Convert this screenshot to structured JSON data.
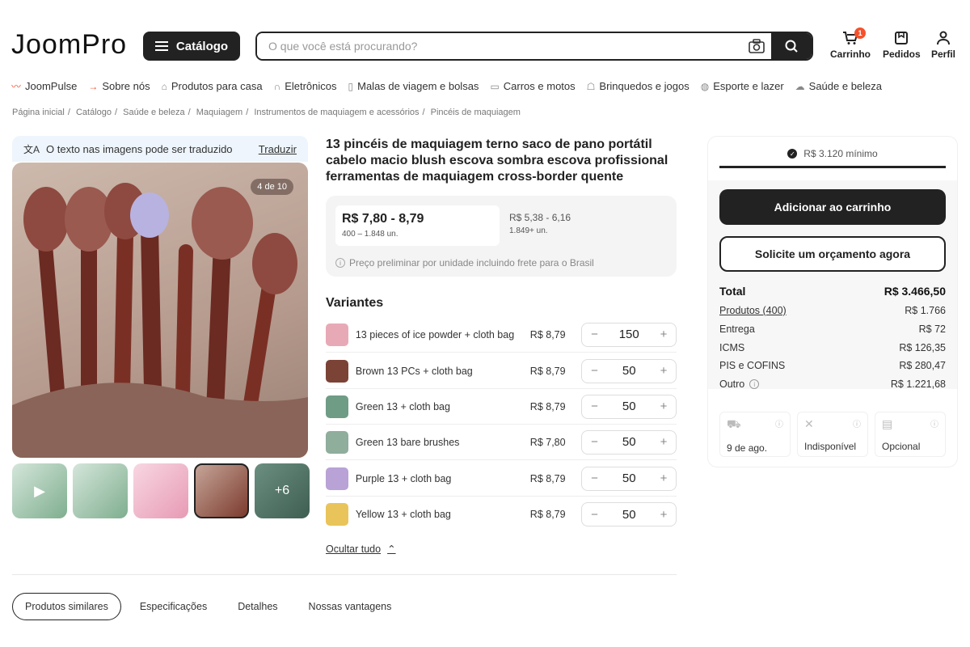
{
  "header": {
    "logo": "JoomPro",
    "catalog_label": "Catálogo",
    "search_placeholder": "O que você está procurando?",
    "cart_label": "Carrinho",
    "cart_count": "1",
    "orders_label": "Pedidos",
    "profile_label": "Perfil"
  },
  "nav": {
    "items": [
      {
        "label": "JoomPulse",
        "icon": "pulse-icon"
      },
      {
        "label": "Sobre nós",
        "icon": "arrow-icon"
      },
      {
        "label": "Produtos para casa",
        "icon": "home-icon"
      },
      {
        "label": "Eletrônicos",
        "icon": "headphones-icon"
      },
      {
        "label": "Malas de viagem e bolsas",
        "icon": "luggage-icon"
      },
      {
        "label": "Carros e motos",
        "icon": "car-icon"
      },
      {
        "label": "Brinquedos e jogos",
        "icon": "toy-icon"
      },
      {
        "label": "Esporte e lazer",
        "icon": "ball-icon"
      },
      {
        "label": "Saúde e beleza",
        "icon": "beauty-icon"
      }
    ]
  },
  "breadcrumb": [
    "Página inicial",
    "Catálogo",
    "Saúde e beleza",
    "Maquiagem",
    "Instrumentos de maquiagem e acessórios",
    "Pincéis de maquiagem"
  ],
  "gallery": {
    "translate_text": "O texto nas imagens pode ser traduzido",
    "translate_link": "Traduzir",
    "counter": "4 de 10",
    "more_count": "+6"
  },
  "product": {
    "title": "13 pincéis de maquiagem terno saco de pano portátil cabelo macio blush escova sombra escova profissional ferramentas de maquiagem cross-border quente",
    "price_current": "R$ 7,80 - 8,79",
    "qty_current": "400 – 1.848 un.",
    "price_alt": "R$ 5,38 - 6,16",
    "qty_alt": "1.849+ un.",
    "price_note": "Preço preliminar por unidade incluindo frete para o Brasil",
    "variants_title": "Variantes",
    "variants": [
      {
        "name": "13 pieces of ice powder + cloth bag",
        "price": "R$ 8,79",
        "qty": "150",
        "color": "#e8a9b6"
      },
      {
        "name": "Brown 13 PCs + cloth bag",
        "price": "R$ 8,79",
        "qty": "50",
        "color": "#7b4336"
      },
      {
        "name": "Green 13 + cloth bag",
        "price": "R$ 8,79",
        "qty": "50",
        "color": "#6f9c85"
      },
      {
        "name": "Green 13 bare brushes",
        "price": "R$ 7,80",
        "qty": "50",
        "color": "#8fae9c"
      },
      {
        "name": "Purple 13 + cloth bag",
        "price": "R$ 8,79",
        "qty": "50",
        "color": "#b8a2d6"
      },
      {
        "name": "Yellow 13 + cloth bag",
        "price": "R$ 8,79",
        "qty": "50",
        "color": "#e9c45a"
      }
    ],
    "hide_all": "Ocultar tudo"
  },
  "tabs": [
    "Produtos similares",
    "Especificações",
    "Detalhes",
    "Nossas vantagens"
  ],
  "panel": {
    "minimum": "R$ 3.120 mínimo",
    "add_to_cart": "Adicionar ao carrinho",
    "request_quote": "Solicite um orçamento agora",
    "summary": [
      {
        "label": "Total",
        "value": "R$ 3.466,50"
      },
      {
        "label": "Produtos (400)",
        "value": "R$ 1.766"
      },
      {
        "label": "Entrega",
        "value": "R$ 72"
      },
      {
        "label": "ICMS",
        "value": "R$ 126,35"
      },
      {
        "label": "PIS e COFINS",
        "value": "R$ 280,47"
      },
      {
        "label": "Outro",
        "value": "R$ 1.221,68"
      }
    ],
    "features": [
      {
        "label": "9 de ago.",
        "icon": "truck-icon"
      },
      {
        "label": "Indisponível",
        "icon": "tools-icon"
      },
      {
        "label": "Opcional",
        "icon": "document-icon"
      }
    ]
  }
}
